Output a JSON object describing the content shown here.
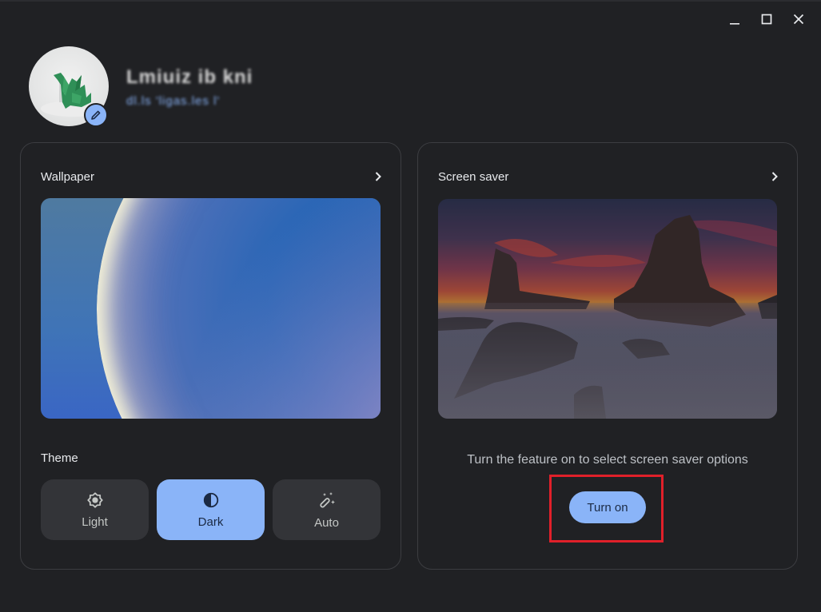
{
  "window": {
    "controls": [
      {
        "name": "minimize",
        "icon": "minimize-icon"
      },
      {
        "name": "maximize",
        "icon": "maximize-icon"
      },
      {
        "name": "close",
        "icon": "close-icon"
      }
    ]
  },
  "profile": {
    "name": "Lmiuiz  ib kni",
    "email": "dl.ls 'ligas.les   l'",
    "avatar_icon": "origami-dragon-avatar",
    "edit_icon": "pencil-icon"
  },
  "wallpaper": {
    "title": "Wallpaper",
    "chevron_icon": "chevron-right-icon",
    "preview_alt": "Current wallpaper"
  },
  "theme": {
    "label": "Theme",
    "options": [
      {
        "label": "Light",
        "icon": "brightness-icon",
        "selected": false
      },
      {
        "label": "Dark",
        "icon": "contrast-icon",
        "selected": true
      },
      {
        "label": "Auto",
        "icon": "magic-wand-icon",
        "selected": false
      }
    ]
  },
  "screensaver": {
    "title": "Screen saver",
    "chevron_icon": "chevron-right-icon",
    "preview_alt": "Sea stacks at sunset",
    "message": "Turn the feature on to select screen saver options",
    "button_label": "Turn on"
  },
  "colors": {
    "background": "#202124",
    "accent": "#8ab4f8",
    "card_border": "#3c3d41",
    "highlight": "#e0202a"
  }
}
